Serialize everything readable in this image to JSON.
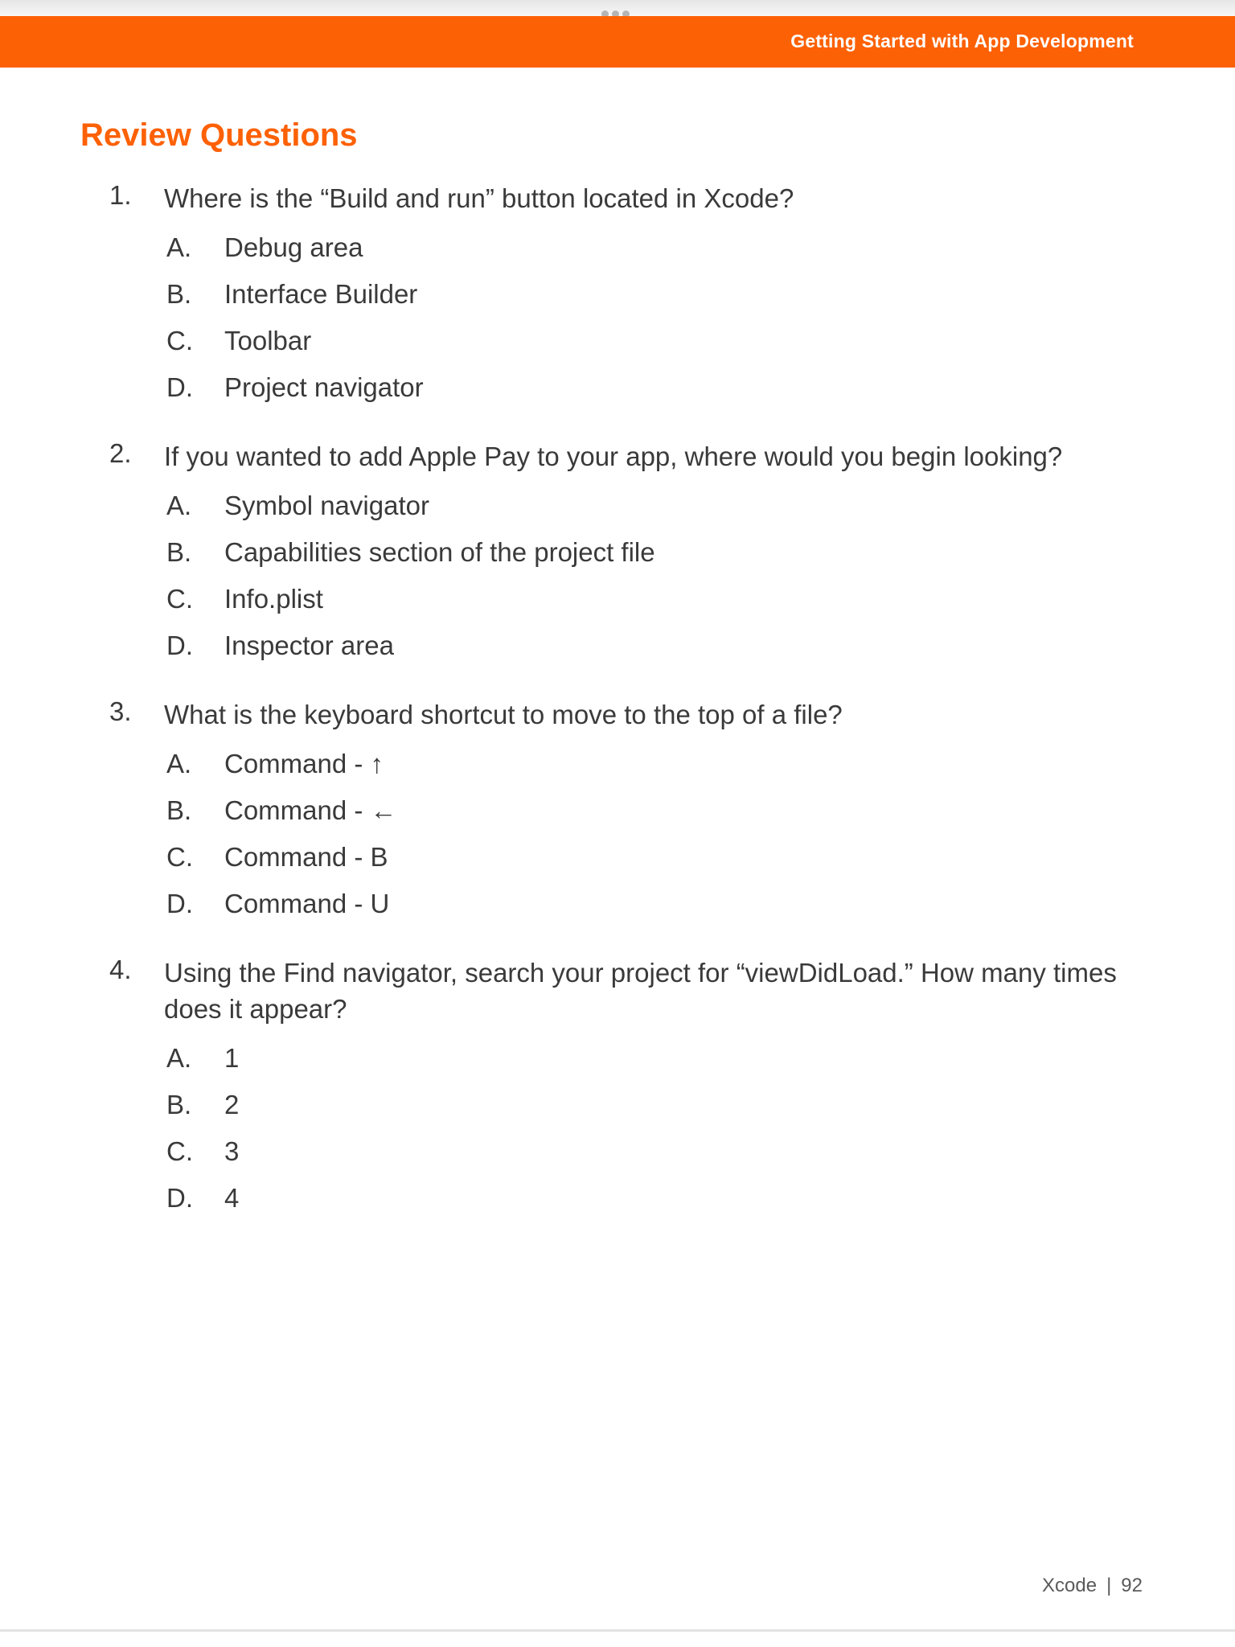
{
  "header": {
    "title": "Getting Started with App Development"
  },
  "page": {
    "heading": "Review Questions"
  },
  "questions": [
    {
      "number": "1.",
      "text": "Where is the “Build and run” button located in Xcode?",
      "options": [
        {
          "letter": "A.",
          "text": "Debug area"
        },
        {
          "letter": "B.",
          "text": "Interface Builder"
        },
        {
          "letter": "C.",
          "text": "Toolbar"
        },
        {
          "letter": "D.",
          "text": "Project navigator"
        }
      ]
    },
    {
      "number": "2.",
      "text": "If you wanted to add Apple Pay to your app, where would you begin looking?",
      "options": [
        {
          "letter": "A.",
          "text": "Symbol navigator"
        },
        {
          "letter": "B.",
          "text": "Capabilities section of the project file"
        },
        {
          "letter": "C.",
          "text": "Info.plist"
        },
        {
          "letter": "D.",
          "text": "Inspector area"
        }
      ]
    },
    {
      "number": "3.",
      "text": "What is the keyboard shortcut to move to the top of a file?",
      "options": [
        {
          "letter": "A.",
          "text": "Command - ↑"
        },
        {
          "letter": "B.",
          "text": "Command - ←"
        },
        {
          "letter": "C.",
          "text": "Command - B"
        },
        {
          "letter": "D.",
          "text": "Command - U"
        }
      ]
    },
    {
      "number": "4.",
      "text": "Using the Find navigator, search your project for “viewDidLoad.” How many times does it appear?",
      "options": [
        {
          "letter": "A.",
          "text": "1"
        },
        {
          "letter": "B.",
          "text": "2"
        },
        {
          "letter": "C.",
          "text": "3"
        },
        {
          "letter": "D.",
          "text": "4"
        }
      ]
    }
  ],
  "footer": {
    "chapter": "Xcode",
    "separator": "|",
    "page_number": "92"
  }
}
